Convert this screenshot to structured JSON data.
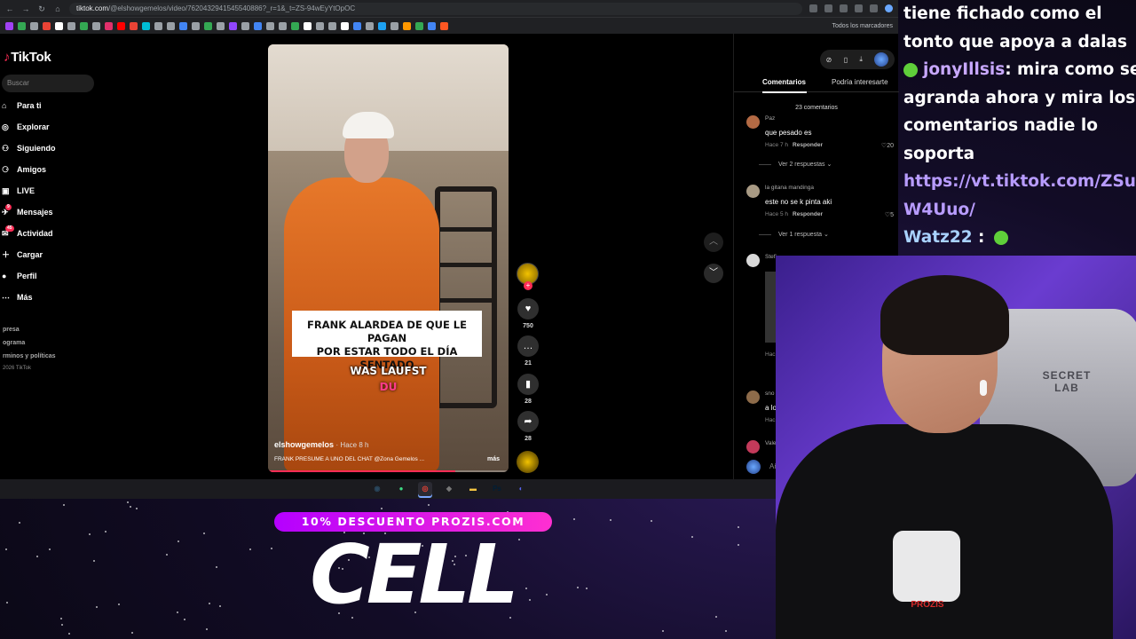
{
  "browser": {
    "url_host": "tiktok.com",
    "url_path": "/@elshowgemelos/video/7620432941545540886?_r=1&_t=ZS-94wEyYtOpOC",
    "bookmarks_all": "Todos los marcadores"
  },
  "tiktok": {
    "logo": "TikTok",
    "search_placeholder": "Buscar",
    "nav": [
      {
        "label": "Para ti",
        "icon": "home-icon"
      },
      {
        "label": "Explorar",
        "icon": "compass-icon"
      },
      {
        "label": "Siguiendo",
        "icon": "following-icon"
      },
      {
        "label": "Amigos",
        "icon": "friends-icon"
      },
      {
        "label": "LIVE",
        "icon": "live-icon"
      },
      {
        "label": "Mensajes",
        "icon": "messages-icon",
        "badge": "9"
      },
      {
        "label": "Actividad",
        "icon": "activity-icon",
        "badge": "45"
      },
      {
        "label": "Cargar",
        "icon": "upload-icon"
      },
      {
        "label": "Perfil",
        "icon": "profile-icon"
      },
      {
        "label": "Más",
        "icon": "more-icon"
      }
    ],
    "footer": [
      "presa",
      "ograma",
      "rminos y políticas"
    ],
    "copyright": "2026 TikTok"
  },
  "video": {
    "caption_line1": "FRANK ALARDEA DE QUE LE PAGAN",
    "caption_line2": "POR ESTAR TODO EL DÍA SENTADO",
    "subtitle_white": "WAS LAUFST",
    "subtitle_pink": "DU",
    "author": "elshowgemelos",
    "time": "· Hace 8 h",
    "description": "FRANK PRESUME A UNO DEL CHAT @Zona Gemelos ...",
    "more": "más",
    "progress": 0.78
  },
  "actions": {
    "likes": "750",
    "comments": "21",
    "saves": "28",
    "shares": "28"
  },
  "comments_panel": {
    "tab_comments": "Comentarios",
    "tab_interest": "Podría interesarte",
    "count": "23 comentarios",
    "items": [
      {
        "user": "Paz",
        "text": "que pesado es",
        "time": "Hace 7 h",
        "reply": "Responder",
        "likes": "20",
        "more": "Ver 2 respuestas"
      },
      {
        "user": "la gitana mandinga",
        "text": "este no se k pinta aki",
        "time": "Hace 5 h",
        "reply": "Responder",
        "likes": "5",
        "more": "Ver 1 respuesta"
      }
    ],
    "partial_user_3": "Stefi",
    "partial_text_4": "a lo",
    "partial_user_4": "sno",
    "partial_user_5": "Vale",
    "partial_meta": "Hac",
    "input_placeholder": "Añ"
  },
  "chat": {
    "lines": [
      {
        "kind": "text",
        "text": "tiene fichado como el"
      },
      {
        "kind": "text",
        "text": "tonto que apoya a dalas"
      },
      {
        "kind": "user",
        "user": "jonyIllsis",
        "text": ": mira como se"
      },
      {
        "kind": "text",
        "text": "agranda ahora y mira los"
      },
      {
        "kind": "text",
        "text": "comentarios nadie lo"
      },
      {
        "kind": "text",
        "text": "soporta"
      },
      {
        "kind": "link",
        "text": "https://vt.tiktok.com/ZSuW"
      },
      {
        "kind": "link",
        "text": "W4Uuo/"
      },
      {
        "kind": "user2",
        "user": "Watz22",
        "text": ":"
      }
    ]
  },
  "webcam": {
    "chair_brand": "SECRET LAB",
    "shirt_brand": "PROZIS"
  },
  "promo": {
    "pill": "10% DESCUENTO PROZIS.COM",
    "big": "CELL"
  },
  "taskbar": [
    "steam-icon",
    "android-icon",
    "chrome-icon",
    "app-icon",
    "folder-icon",
    "photoshop-icon",
    "discord-icon"
  ]
}
